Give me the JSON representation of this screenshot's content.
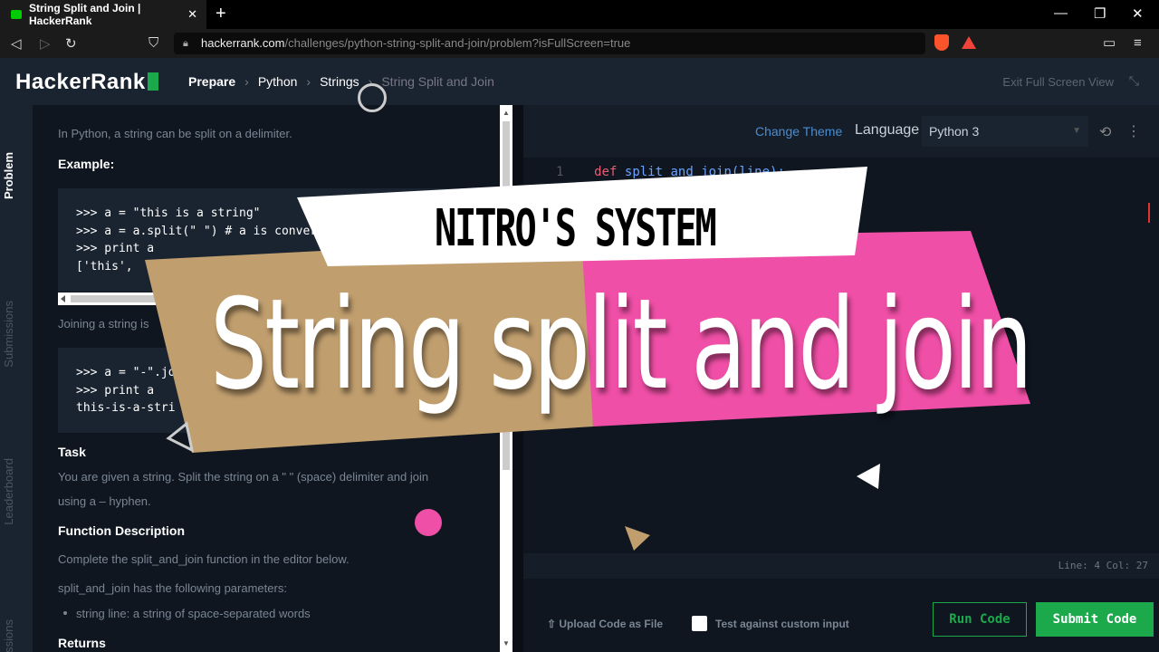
{
  "browser": {
    "tab_title": "String Split and Join | HackerRank",
    "url_host": "hackerrank.com",
    "url_path": "/challenges/python-string-split-and-join/problem?isFullScreen=true"
  },
  "header": {
    "logo": "HackerRank",
    "breadcrumb": [
      "Prepare",
      "Python",
      "Strings",
      "String Split and Join"
    ],
    "exit_fullscreen": "Exit Full Screen View"
  },
  "left_tabs": [
    "Problem",
    "Submissions",
    "Leaderboard",
    "ssions"
  ],
  "problem": {
    "intro": "In Python, a string can be split on a delimiter.",
    "example_heading": "Example:",
    "example_code": ">>> a = \"this is a string\"\n>>> a = a.split(\" \") # a is convert\n>>> print a\n['this',",
    "join_text": "Joining a string is",
    "join_code": ">>> a = \"-\".jo\n>>> print a\nthis-is-a-stri",
    "task_heading": "Task",
    "task_text_1": "You are given a string. Split the string on a \" \" (space) delimiter and join",
    "task_text_2": "using a – hyphen.",
    "fd_heading": "Function Description",
    "fd_text": "Complete the split_and_join function in the editor below.",
    "params_text": "split_and_join has the following parameters:",
    "param_1": "string line: a string of space-separated words",
    "returns_heading": "Returns"
  },
  "editor": {
    "change_theme": "Change Theme",
    "language_label": "Language",
    "language_value": "Python 3",
    "line_number": "1",
    "code_kw": "def",
    "code_fn": "split_and_join(line):",
    "status": "Line: 4 Col: 27",
    "upload": "Upload Code as File",
    "custom_input": "Test against custom input",
    "run": "Run Code",
    "submit": "Submit Code"
  },
  "overlay": {
    "brand": "NITRO'S SYSTEM",
    "title": "String split and join",
    "colors": {
      "tan": "#c09e6e",
      "pink": "#ef4fa6",
      "white": "#ffffff"
    }
  }
}
